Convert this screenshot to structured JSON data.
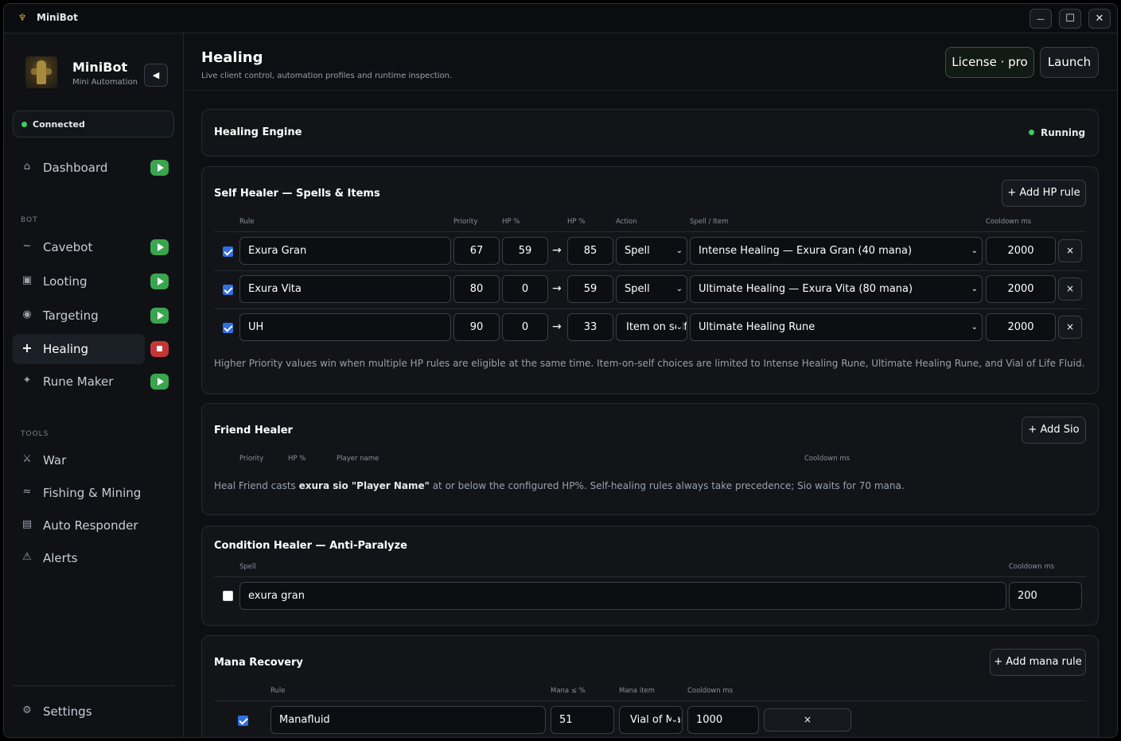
{
  "app": {
    "title": "MiniBot",
    "window_controls": {
      "minimize": "—",
      "maximize": "☐",
      "close": "✕"
    }
  },
  "sidebar": {
    "brand_name": "MiniBot",
    "brand_subtitle": "Mini Automation",
    "collapse_icon": "◀",
    "connection": "Connected",
    "dashboard": "Dashboard",
    "section_bot": "BOT",
    "section_tools": "TOOLS",
    "bot_items": [
      {
        "label": "Cavebot",
        "icon": "~",
        "state": "play"
      },
      {
        "label": "Looting",
        "icon": "▣",
        "state": "play"
      },
      {
        "label": "Targeting",
        "icon": "◉",
        "state": "play"
      },
      {
        "label": "Healing",
        "icon": "+",
        "state": "stop"
      },
      {
        "label": "Rune Maker",
        "icon": "✦",
        "state": "play"
      }
    ],
    "tool_items": [
      {
        "label": "War",
        "icon": "⚔"
      },
      {
        "label": "Fishing & Mining",
        "icon": "≈"
      },
      {
        "label": "Auto Responder",
        "icon": "▤"
      },
      {
        "label": "Alerts",
        "icon": "⚠"
      }
    ],
    "settings": "Settings"
  },
  "header": {
    "title": "Healing",
    "subtitle": "Live client control, automation profiles and runtime inspection.",
    "license_button": "License · pro",
    "launch_button": "Launch"
  },
  "engine": {
    "title": "Healing Engine",
    "status": "Running"
  },
  "self_healer": {
    "title": "Self Healer — Spells & Items",
    "add_button": "+ Add HP rule",
    "columns": {
      "rule": "Rule",
      "priority": "Priority",
      "hp_from": "HP %",
      "hp_to": "HP %",
      "action": "Action",
      "spell_item": "Spell / Item",
      "cooldown": "Cooldown ms"
    },
    "arrow": "→",
    "delete_label": "×",
    "rules": [
      {
        "enabled": true,
        "name": "Exura Gran",
        "priority": "67",
        "hp_from": "59",
        "hp_to": "85",
        "action": "Spell",
        "spell": "Intense Healing — Exura Gran (40 mana)",
        "cooldown": "2000"
      },
      {
        "enabled": true,
        "name": "Exura Vita",
        "priority": "80",
        "hp_from": "0",
        "hp_to": "59",
        "action": "Spell",
        "spell": "Ultimate Healing — Exura Vita (80 mana)",
        "cooldown": "2000"
      },
      {
        "enabled": true,
        "name": "UH",
        "priority": "90",
        "hp_from": "0",
        "hp_to": "33",
        "action": "Item on self",
        "spell": "Ultimate Healing Rune",
        "cooldown": "2000"
      }
    ],
    "note": "Higher Priority values win when multiple HP rules are eligible at the same time. Item-on-self choices are limited to Intense Healing Rune, Ultimate Healing Rune, and Vial of Life Fluid."
  },
  "friend_healer": {
    "title": "Friend Healer",
    "add_button": "+ Add Sio",
    "columns": {
      "priority": "Priority",
      "hp": "HP %",
      "player": "Player name",
      "cooldown": "Cooldown ms"
    },
    "note_prefix": "Heal Friend casts ",
    "note_cmd": "exura sio \"Player Name\"",
    "note_suffix": " at or below the configured HP%. Self-healing rules always take precedence; Sio waits for 70 mana."
  },
  "condition_healer": {
    "title": "Condition Healer — Anti-Paralyze",
    "columns": {
      "spell": "Spell",
      "cooldown": "Cooldown ms"
    },
    "enabled": false,
    "spell": "exura gran",
    "cooldown": "200"
  },
  "mana_recovery": {
    "title": "Mana Recovery",
    "add_button": "+ Add mana rule",
    "columns": {
      "rule": "Rule",
      "mana": "Mana ≤ %",
      "item": "Mana item",
      "cooldown": "Cooldown ms"
    },
    "rules": [
      {
        "enabled": true,
        "name": "Manafluid",
        "mana": "51",
        "item": "Vial of Mana",
        "cooldown": "1000"
      }
    ],
    "delete_label": "×"
  }
}
